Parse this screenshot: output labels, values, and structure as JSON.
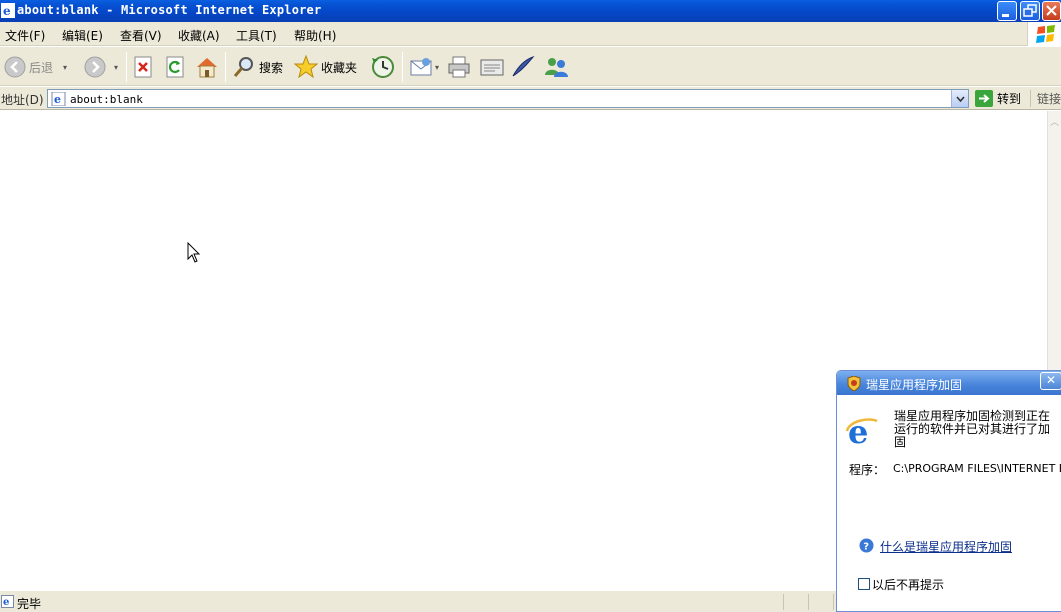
{
  "window": {
    "title": "about:blank - Microsoft Internet Explorer"
  },
  "menu": {
    "items": [
      {
        "label": "文件(F)"
      },
      {
        "label": "编辑(E)"
      },
      {
        "label": "查看(V)"
      },
      {
        "label": "收藏(A)"
      },
      {
        "label": "工具(T)"
      },
      {
        "label": "帮助(H)"
      }
    ]
  },
  "toolbar": {
    "back_label": "后退",
    "search_label": "搜索",
    "favorites_label": "收藏夹"
  },
  "address": {
    "label": "地址(D)",
    "url": "about:blank",
    "go_label": "转到",
    "links_label": "链接"
  },
  "status": {
    "text": "完毕"
  },
  "popup": {
    "title": "瑞星应用程序加固",
    "close_glyph": "✕",
    "message": "瑞星应用程序加固检测到正在运行的软件并已对其进行了加固",
    "program_label": "程序：",
    "program_value": "C:\\PROGRAM FILES\\INTERNET EX",
    "help_link": "什么是瑞星应用程序加固",
    "checkbox_label": "以后不再提示",
    "checkbox_checked": false
  },
  "colors": {
    "titlebar": "#0653d4",
    "chrome": "#ece9d8",
    "popup_title": "#4a86dc",
    "link": "#0b2e8c"
  }
}
